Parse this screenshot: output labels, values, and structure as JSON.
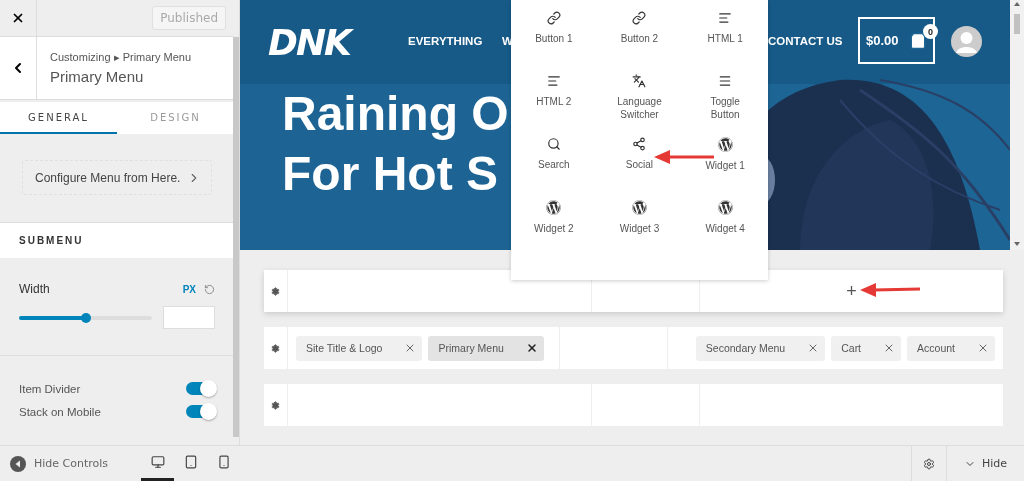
{
  "sidebar": {
    "publish_button": "Published",
    "breadcrumb": "Customizing ▸ Primary Menu",
    "title": "Primary Menu",
    "tabs": [
      {
        "label": "GENERAL",
        "selected": true
      },
      {
        "label": "DESIGN",
        "selected": false
      }
    ],
    "configure_button": "Configure Menu from Here.",
    "section_heading": "SUBMENU",
    "width": {
      "label": "Width",
      "unit": "PX",
      "level": 0.5
    },
    "toggles": [
      {
        "label": "Item Divider",
        "on": true
      },
      {
        "label": "Stack on Mobile",
        "on": true
      }
    ],
    "footer": {
      "hide_controls": "Hide Controls",
      "devices": [
        {
          "kind": "desktop",
          "selected": true
        },
        {
          "kind": "tablet",
          "selected": false
        },
        {
          "kind": "mobile",
          "selected": false
        }
      ]
    }
  },
  "preview": {
    "logo": "DNK",
    "nav": [
      "EVERYTHING",
      "W",
      "CONTACT US"
    ],
    "cart_total": "$0.00",
    "cart_count": "0",
    "headline": [
      "Raining O",
      "For Hot S"
    ]
  },
  "popup": {
    "items": [
      {
        "label": "Button 1",
        "kind": "link"
      },
      {
        "label": "Button 2",
        "kind": "link"
      },
      {
        "label": "HTML 1",
        "kind": "html"
      },
      {
        "label": "HTML 2",
        "kind": "html"
      },
      {
        "label": "Language Switcher",
        "kind": "language"
      },
      {
        "label": "Toggle Button",
        "kind": "menu"
      },
      {
        "label": "Search",
        "kind": "search"
      },
      {
        "label": "Social",
        "kind": "share"
      },
      {
        "label": "Widget 1",
        "kind": "wordpress"
      },
      {
        "label": "Widget 2",
        "kind": "wordpress"
      },
      {
        "label": "Widget 3",
        "kind": "wordpress"
      },
      {
        "label": "Widget 4",
        "kind": "wordpress"
      }
    ]
  },
  "builder": {
    "rows": [
      {
        "columns": [
          [],
          [],
          [
            {
              "kind": "add",
              "label": "+"
            }
          ]
        ]
      },
      {
        "columns": [
          [
            {
              "kind": "chip",
              "label": "Site Title & Logo",
              "selected": false
            },
            {
              "kind": "chip",
              "label": "Primary Menu",
              "selected": true
            }
          ],
          [],
          [
            {
              "kind": "chip",
              "label": "Secondary Menu",
              "selected": false
            },
            {
              "kind": "chip",
              "label": "Cart",
              "selected": false
            },
            {
              "kind": "chip",
              "label": "Account",
              "selected": false
            }
          ]
        ]
      },
      {
        "columns": [
          [],
          [],
          []
        ]
      }
    ],
    "hide_button": "Hide"
  }
}
